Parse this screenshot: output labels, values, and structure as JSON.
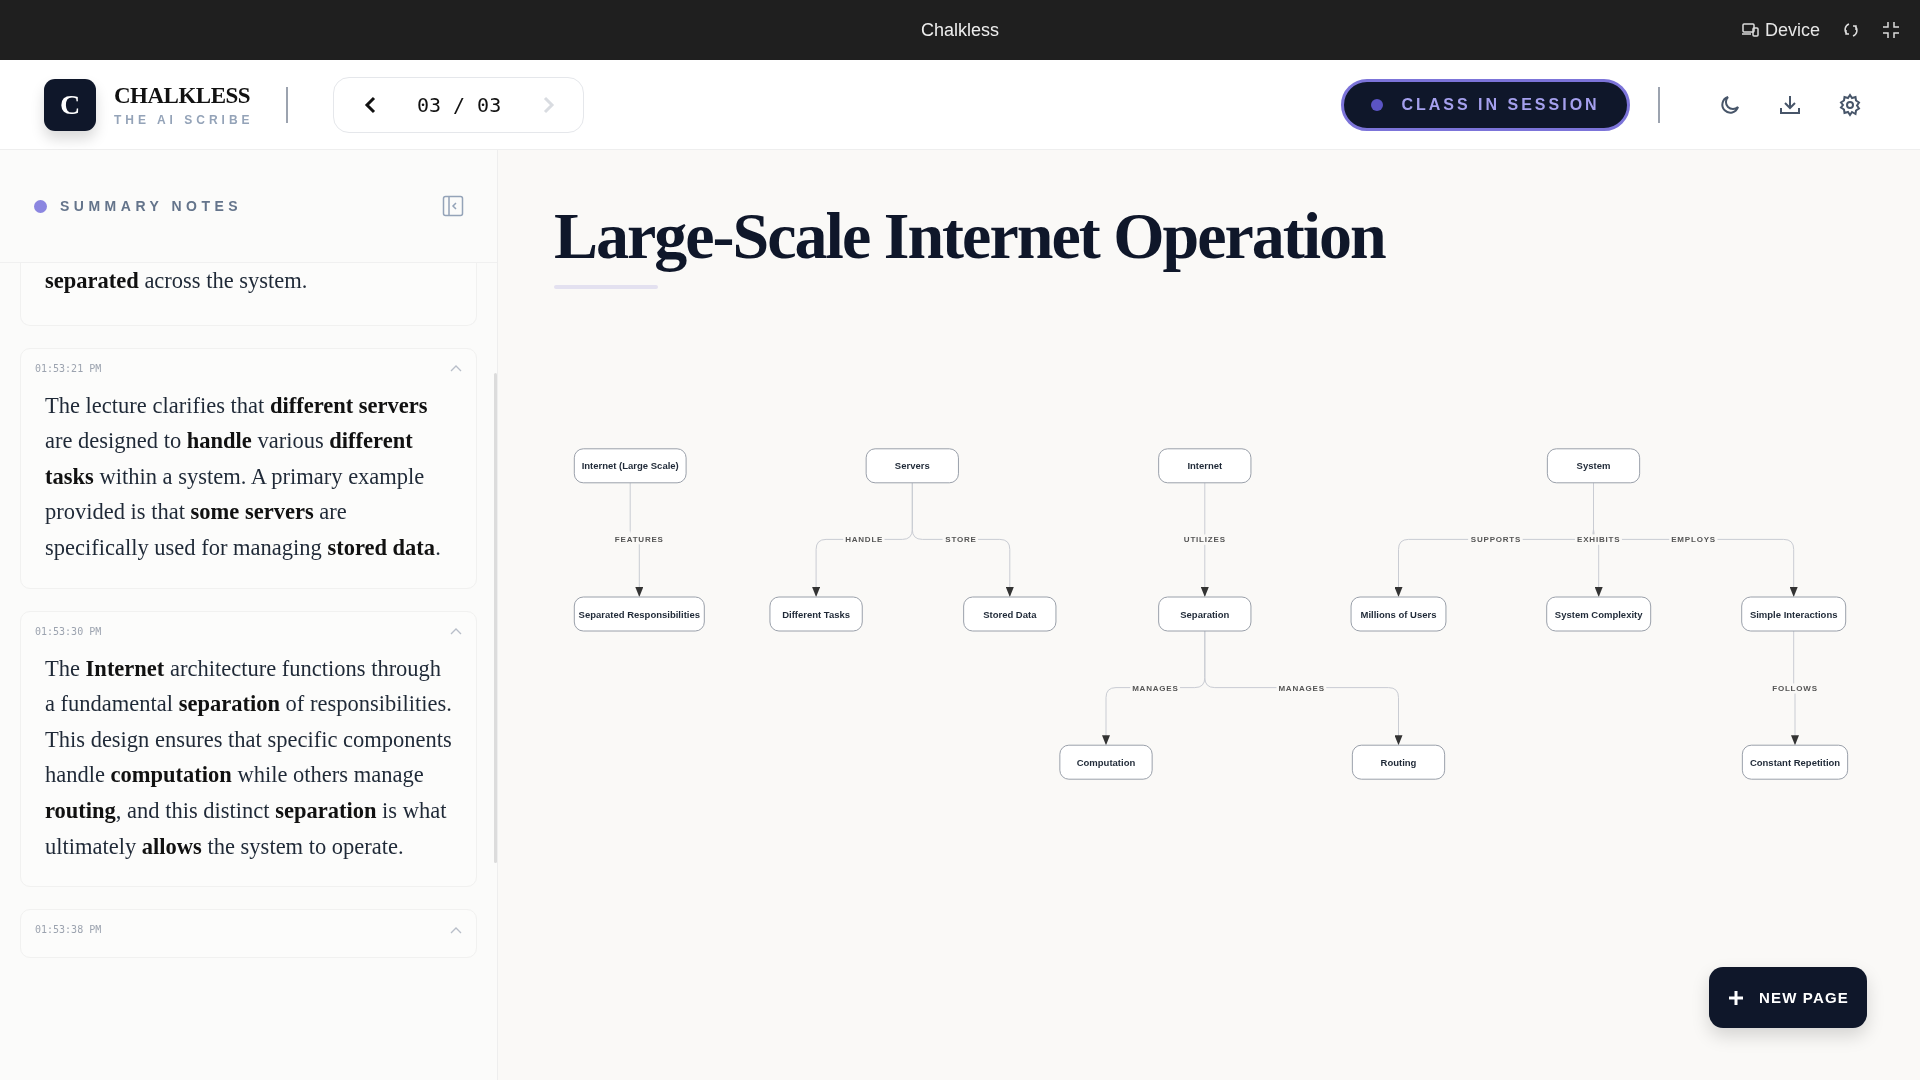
{
  "app_bar": {
    "title": "Chalkless",
    "device_label": "Device"
  },
  "header": {
    "logo_letter": "C",
    "brand": "CHALKLESS",
    "tagline": "THE AI SCRIBE",
    "pager": {
      "text": "03 / 03",
      "prev_disabled": false,
      "next_disabled": true
    },
    "session_button": {
      "label": "CLASS IN SESSION",
      "on": true
    }
  },
  "sidebar": {
    "title": "SUMMARY NOTES",
    "notes": [
      {
        "text": "**separated** across the system."
      },
      {
        "time": "01:53:21 PM",
        "expanded": true,
        "text": "The lecture clarifies that **different servers** are designed to **handle** various **different tasks** within a system. A primary example provided is that **some servers** are specifically used for managing **stored data**."
      },
      {
        "time": "01:53:30 PM",
        "expanded": true,
        "text": "The **Internet** architecture functions through a fundamental **separation** of responsibilities. This design ensures that specific components handle **computation** while others manage **routing**, and this distinct **separation** is what ultimately **allows** the system to operate."
      },
      {
        "time": "01:53:38 PM",
        "expanded": true
      }
    ]
  },
  "page": {
    "title": "Large-Scale Internet Operation",
    "diagram": {
      "roots": [
        {
          "label": "Internet (Large Scale)",
          "children": [
            {
              "edge_label": "FEATURES",
              "label": "Separated Responsibilities"
            }
          ]
        },
        {
          "label": "Servers",
          "children": [
            {
              "edge_label": "HANDLE",
              "label": "Different Tasks"
            },
            {
              "edge_label": "STORE",
              "label": "Stored Data"
            }
          ]
        },
        {
          "label": "Internet",
          "children": [
            {
              "edge_label": "UTILIZES",
              "label": "Separation",
              "children": [
                {
                  "edge_label": "MANAGES",
                  "label": "Computation"
                },
                {
                  "edge_label": "MANAGES",
                  "label": "Routing"
                }
              ]
            }
          ]
        },
        {
          "label": "System",
          "children": [
            {
              "edge_label": "SUPPORTS",
              "label": "Millions of Users"
            },
            {
              "edge_label": "EXHIBITS",
              "label": "System Complexity"
            },
            {
              "edge_label": "EMPLOYS",
              "label": "Simple Interactions",
              "children": [
                {
                  "edge_label": "FOLLOWS",
                  "label": "Constant Repetition"
                }
              ]
            }
          ]
        }
      ]
    },
    "new_page_button": "NEW PAGE"
  }
}
